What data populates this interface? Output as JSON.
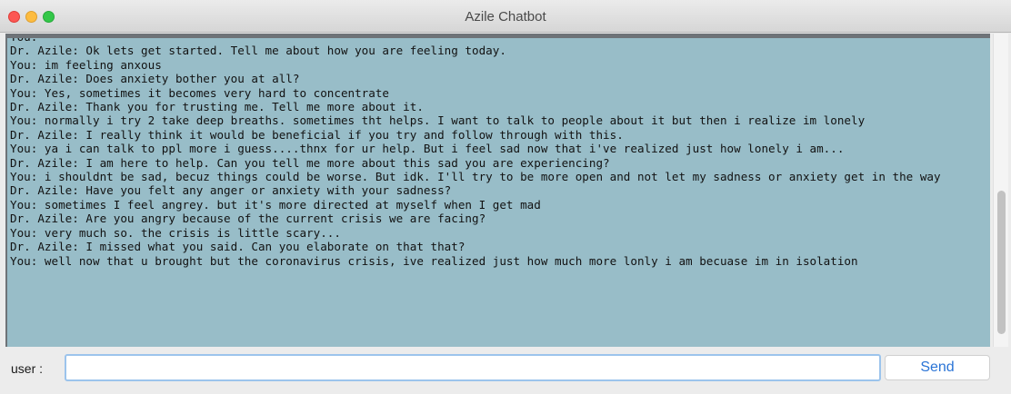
{
  "window": {
    "title": "Azile Chatbot"
  },
  "chat": {
    "lines": [
      "You:",
      "Dr. Azile: Ok lets get started. Tell me about how you are feeling today.",
      "You: im feeling anxous",
      "Dr. Azile: Does anxiety bother you at all?",
      "You: Yes, sometimes it becomes very hard to concentrate",
      "Dr. Azile: Thank you for trusting me. Tell me more about it.",
      "You: normally i try 2 take deep breaths. sometimes tht helps. I want to talk to people about it but then i realize im lonely",
      "Dr. Azile: I really think it would be beneficial if you try and follow through with this.",
      "You: ya i can talk to ppl more i guess....thnx for ur help. But i feel sad now that i've realized just how lonely i am...",
      "Dr. Azile: I am here to help. Can you tell me more about this sad you are experiencing?",
      "You: i shouldnt be sad, becuz things could be worse. But idk. I'll try to be more open and not let my sadness or anxiety get in the way",
      "Dr. Azile: Have you felt any anger or anxiety with your sadness?",
      "You: sometimes I feel angrey. but it's more directed at myself when I get mad",
      "Dr. Azile: Are you angry because of the current crisis we are facing?",
      "You: very much so. the crisis is little scary...",
      "Dr. Azile: I missed what you said. Can you elaborate on that that?",
      "You: well now that u brought but the coronavirus crisis, ive realized just how much more lonly i am becuase im in isolation"
    ]
  },
  "input_row": {
    "label": "user :",
    "value": "",
    "send_label": "Send"
  },
  "colors": {
    "chat_background": "#98bdc8",
    "send_text": "#2a74d6",
    "input_focus_border": "#9cc4ec"
  }
}
